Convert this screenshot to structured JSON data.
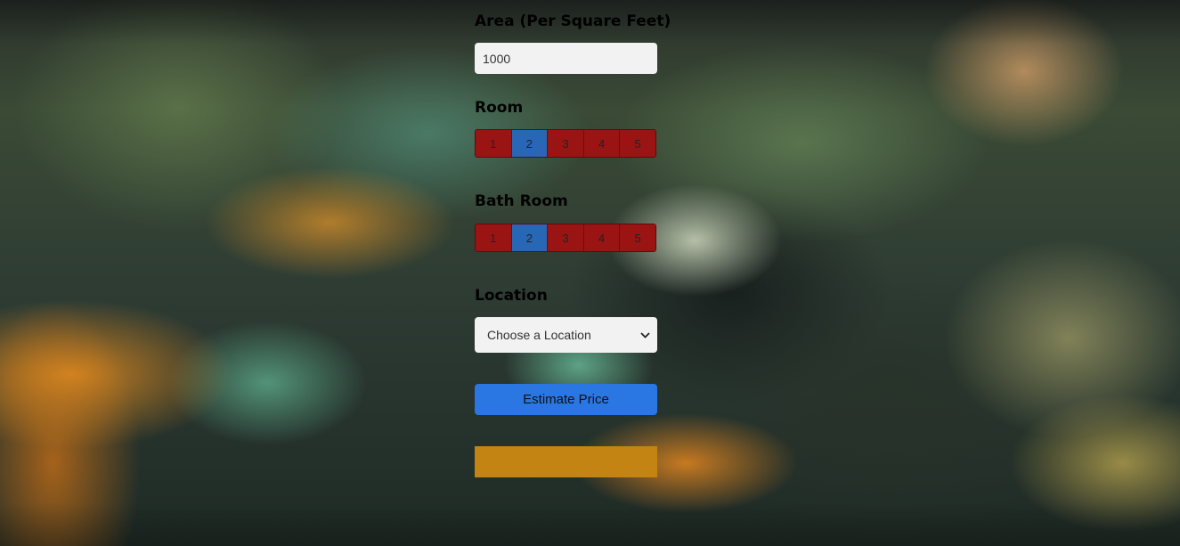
{
  "form": {
    "area_label": "Area (Per Square Feet)",
    "area_value": "1000",
    "room_label": "Room",
    "room_options": [
      "1",
      "2",
      "3",
      "4",
      "5"
    ],
    "room_selected": "2",
    "bath_label": "Bath Room",
    "bath_options": [
      "1",
      "2",
      "3",
      "4",
      "5"
    ],
    "bath_selected": "2",
    "location_label": "Location",
    "location_selected": "Choose a Location",
    "estimate_button": "Estimate Price",
    "result_text": ""
  },
  "colors": {
    "option_default": "#9b1414",
    "option_selected": "#2767b5",
    "button": "#2a76e2",
    "result_box": "#c38413"
  },
  "icons": {
    "select_arrow": "chevron-down-icon"
  }
}
